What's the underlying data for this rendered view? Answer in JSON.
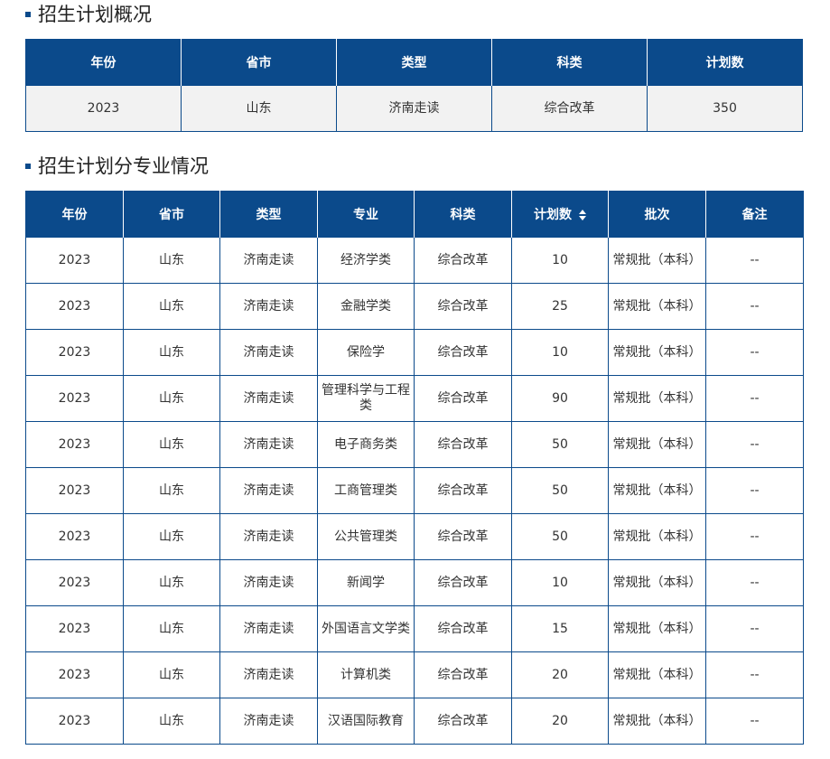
{
  "summary": {
    "title": "招生计划概况",
    "headers": [
      "年份",
      "省市",
      "类型",
      "科类",
      "计划数"
    ],
    "row": [
      "2023",
      "山东",
      "济南走读",
      "综合改革",
      "350"
    ]
  },
  "detail": {
    "title": "招生计划分专业情况",
    "headers": [
      "年份",
      "省市",
      "类型",
      "专业",
      "科类",
      "计划数",
      "批次",
      "备注"
    ],
    "rows": [
      [
        "2023",
        "山东",
        "济南走读",
        "经济学类",
        "综合改革",
        "10",
        "常规批（本科）",
        "--"
      ],
      [
        "2023",
        "山东",
        "济南走读",
        "金融学类",
        "综合改革",
        "25",
        "常规批（本科）",
        "--"
      ],
      [
        "2023",
        "山东",
        "济南走读",
        "保险学",
        "综合改革",
        "10",
        "常规批（本科）",
        "--"
      ],
      [
        "2023",
        "山东",
        "济南走读",
        "管理科学与工程类",
        "综合改革",
        "90",
        "常规批（本科）",
        "--"
      ],
      [
        "2023",
        "山东",
        "济南走读",
        "电子商务类",
        "综合改革",
        "50",
        "常规批（本科）",
        "--"
      ],
      [
        "2023",
        "山东",
        "济南走读",
        "工商管理类",
        "综合改革",
        "50",
        "常规批（本科）",
        "--"
      ],
      [
        "2023",
        "山东",
        "济南走读",
        "公共管理类",
        "综合改革",
        "50",
        "常规批（本科）",
        "--"
      ],
      [
        "2023",
        "山东",
        "济南走读",
        "新闻学",
        "综合改革",
        "10",
        "常规批（本科）",
        "--"
      ],
      [
        "2023",
        "山东",
        "济南走读",
        "外国语言文学类",
        "综合改革",
        "15",
        "常规批（本科）",
        "--"
      ],
      [
        "2023",
        "山东",
        "济南走读",
        "计算机类",
        "综合改革",
        "20",
        "常规批（本科）",
        "--"
      ],
      [
        "2023",
        "山东",
        "济南走读",
        "汉语国际教育",
        "综合改革",
        "20",
        "常规批（本科）",
        "--"
      ]
    ]
  },
  "colors": {
    "header_bg": "#0b4a8b",
    "summary_row_bg": "#f2f2f2"
  },
  "icons": {
    "sort": "sort-icon"
  }
}
